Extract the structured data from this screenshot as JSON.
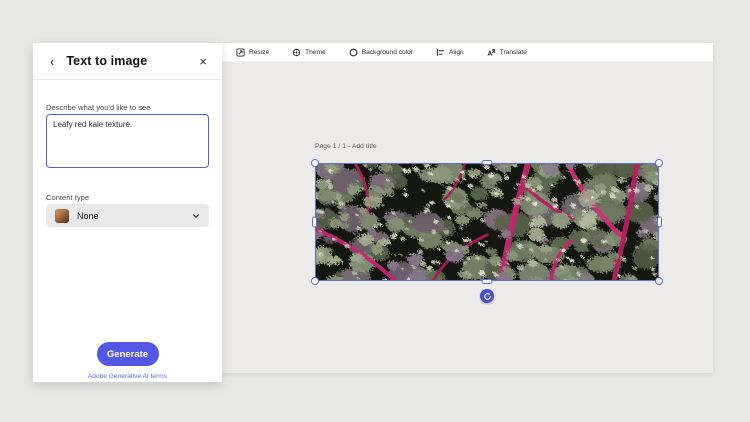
{
  "window": {
    "background": "#e7e7e6",
    "workspace_background": "#ecebe9"
  },
  "toolbar": {
    "items": [
      {
        "label": "Resize",
        "icon": "resize-icon"
      },
      {
        "label": "Theme",
        "icon": "theme-icon"
      },
      {
        "label": "Background color",
        "icon": "background-color-icon"
      },
      {
        "label": "Align",
        "icon": "align-icon"
      },
      {
        "label": "Translate",
        "icon": "translate-icon"
      }
    ]
  },
  "panel": {
    "back_icon": "‹",
    "title": "Text to image",
    "close_icon": "×",
    "prompt_label": "Describe what you'd like to see",
    "prompt_value": "Leafy red kale texture.",
    "content_type_label": "Content type",
    "content_type_value": "None",
    "generate_label": "Generate",
    "terms_link": "Adobe Generative AI terms"
  },
  "canvas": {
    "page_label": "Page 1 / 1 - Add title",
    "selected_object": "kale-photo",
    "image_description": "Close-up photo of curly kale leaves with magenta-red stems on dark background"
  },
  "colors": {
    "accent": "#5258e4",
    "selection": "#5b6ee8",
    "rotate_handle": "#4a50cf",
    "link": "#5c6bea",
    "kale_stem": "#c22570",
    "kale_leaf": "#8d987c"
  }
}
